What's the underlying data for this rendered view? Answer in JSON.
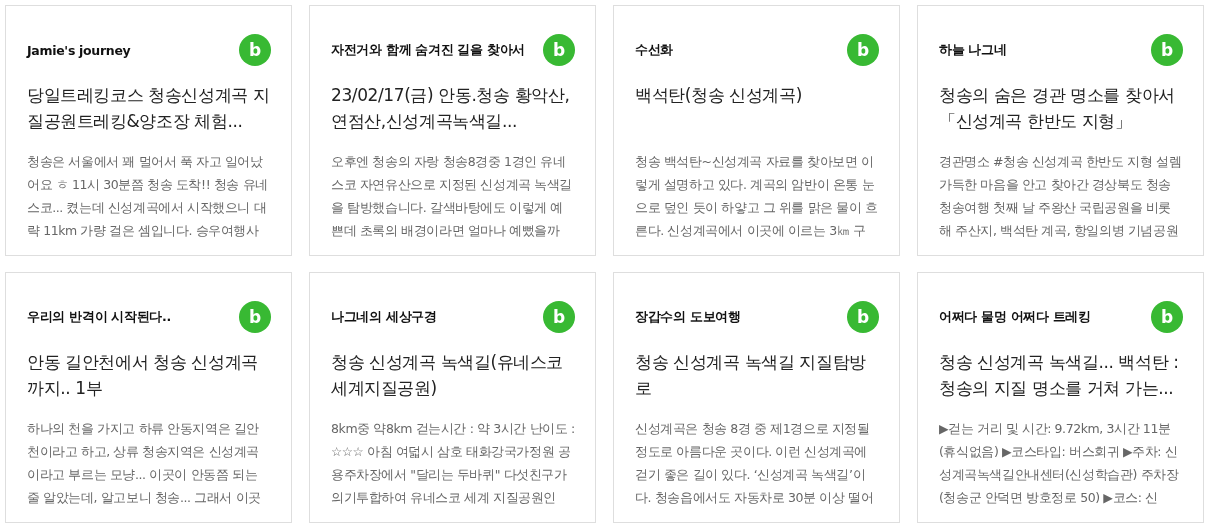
{
  "cards": [
    {
      "badge": "b",
      "blog": "Jamie's journey",
      "title": "당일트레킹코스 청송신성계곡 지질공원트레킹&양조장 체험...",
      "excerpt": "청송은 서울에서 꽤 멀어서 푹 자고 일어났어요 ㅎ 11시 30분쯤 청송 도착!! 청송 유네스코... 켰는데 신성계곡에서 시작했으니 대략 11km 가량 걸은 셈입니다. 승우여행사"
    },
    {
      "badge": "b",
      "blog": "자전거와 함께 숨겨진 길을 찾아서",
      "title": "23/02/17(금) 안동.청송 황악산,연점산,신성계곡녹색길...",
      "excerpt": "오후엔 청송의 자랑 청송8경중 1경인 유네스코 자연유산으로 지정된 신성계곡 녹색길을 탐방했습니다. 갈색바탕에도 이렇게 예쁜데 초록의 배경이라면 얼마나 예뻤을까"
    },
    {
      "badge": "b",
      "blog": "수선화",
      "title": "백석탄(청송 신성계곡)",
      "excerpt": "청송 백석탄~신성계곡 자료를 찾아보면 이렇게 설명하고 있다. 계곡의 암반이 온통 눈으로 덮인 듯이 하얗고 그 위를 맑은 물이 흐른다. 신성계곡에서 이곳에 이르는 3㎞ 구"
    },
    {
      "badge": "b",
      "blog": "하늘 나그네",
      "title": "청송의 숨은 경관 명소를 찾아서 「신성계곡 한반도 지형」",
      "excerpt": "경관명소 #청송 신성계곡 한반도 지형 설렘 가득한 마음을 안고 찾아간 경상북도 청송 청송여행 첫째 날 주왕산 국립공원을 비롯해 주산지, 백석탄 계곡, 항일의병 기념공원"
    },
    {
      "badge": "b",
      "blog": "우리의 반격이 시작된다..",
      "title": "안동 길안천에서 청송 신성계곡까지.. 1부",
      "excerpt": "하나의 천을 가지고 하류 안동지역은 길안천이라고 하고, 상류 청송지역은 신성계곡이라고 부르는 모냥... 이곳이 안동쯤 되는 줄 알았는데, 알고보니 청송... 그래서 이곳"
    },
    {
      "badge": "b",
      "blog": "나그네의 세상구경",
      "title": "청송 신성계곡 녹색길(유네스코 세계지질공원)",
      "excerpt": "8km중 약8km 걷는시간 : 약 3시간 난이도 : ☆☆☆ 아침 여덟시 삼호 태화강국가정원 공용주차장에서 \"달리는 두바퀴\" 다섯친구가 의기투합하여 유네스코 세계 지질공원인"
    },
    {
      "badge": "b",
      "blog": "장갑수의 도보여행",
      "title": "청송 신성계곡 녹색길 지질탐방로",
      "excerpt": "신성계곡은 청송 8경 중 제1경으로 지정될 정도로 아름다운 곳이다. 이런 신성계곡에 걷기 좋은 길이 있다. ‘신성계곡 녹색길’이다. 청송읍에서도 자동차로 30분 이상 떨어"
    },
    {
      "badge": "b",
      "blog": "어쩌다 물멍 어쩌다 트레킹",
      "title": "청송 신성계곡 녹색길... 백석탄 : 청송의 지질 명소를 거쳐 가는...",
      "excerpt": "▶걷는 거리 및 시간: 9.72km, 3시간 11분 (휴식없음) ▶코스타입: 버스회귀 ▶주차: 신성계곡녹색길안내센터(신성학습관) 주차장(청송군 안덕면 방호정로 50) ▶코스: 신"
    }
  ]
}
